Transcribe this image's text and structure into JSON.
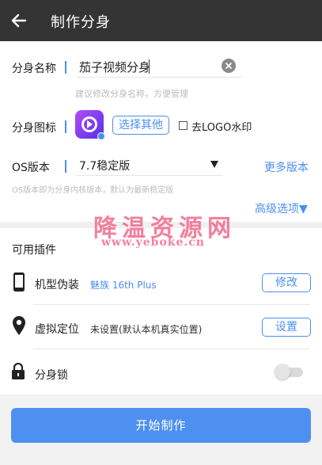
{
  "appbar": {
    "title": "制作分身",
    "back_icon": "arrow-left-icon"
  },
  "name_row": {
    "label": "分身名称",
    "value": "茄子视频分身",
    "hint": "建议修改分身名称，方便管理",
    "clear_icon": "clear-circle-icon"
  },
  "icon_row": {
    "label": "分身图标",
    "choose_label": "选择其他",
    "remove_logo_label": "去LOGO水印",
    "remove_logo_checked": false
  },
  "os_row": {
    "label": "OS版本",
    "selected": "7.7稳定版",
    "more_link": "更多版本",
    "hint": "OS版本即为分身内核版本，默认为最新稳定版",
    "advanced_link": "高级选项▼"
  },
  "watermark": {
    "line1": "降温资源网",
    "line2": "www.yeboke.cn"
  },
  "plugins": {
    "title": "可用插件",
    "items": [
      {
        "name": "机型伪装",
        "value": "魅族 16th Plus",
        "button": "修改",
        "icon": "phone-icon"
      },
      {
        "name": "虚拟定位",
        "value": "未设置(默认本机真实位置)",
        "button": "设置",
        "icon": "location-pin-icon"
      },
      {
        "name": "分身锁",
        "icon": "lock-icon",
        "toggle_on": false
      }
    ]
  },
  "start_button": "开始制作",
  "colors": {
    "accent": "#4a8ff0",
    "appbar": "#343434",
    "watermark": "#f26b8c"
  }
}
